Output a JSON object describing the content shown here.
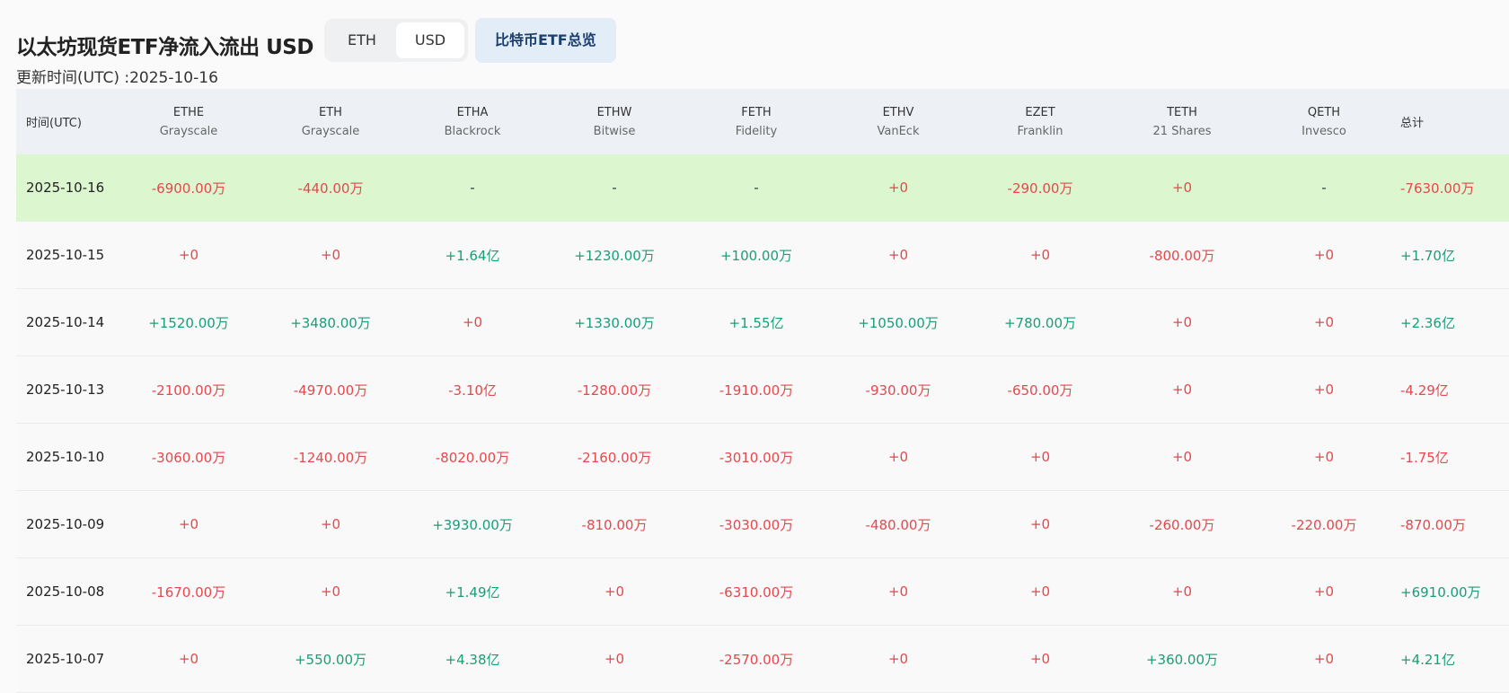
{
  "header": {
    "title": "以太坊现货ETF净流入流出 USD",
    "toggle": [
      "ETH",
      "USD"
    ],
    "toggle_selected": "USD",
    "btc_button": "比特币ETF总览",
    "updated": "更新时间(UTC) :2025-10-16"
  },
  "colors": {
    "negative": "#e5484d",
    "positive": "#1a9e76",
    "highlight_row": "#dcf7d0"
  },
  "table": {
    "date_header": "时间(UTC)",
    "total_header": "总计",
    "columns": [
      {
        "ticker": "ETHE",
        "issuer": "Grayscale"
      },
      {
        "ticker": "ETH",
        "issuer": "Grayscale"
      },
      {
        "ticker": "ETHA",
        "issuer": "Blackrock"
      },
      {
        "ticker": "ETHW",
        "issuer": "Bitwise"
      },
      {
        "ticker": "FETH",
        "issuer": "Fidelity"
      },
      {
        "ticker": "ETHV",
        "issuer": "VanEck"
      },
      {
        "ticker": "EZET",
        "issuer": "Franklin"
      },
      {
        "ticker": "TETH",
        "issuer": "21 Shares"
      },
      {
        "ticker": "QETH",
        "issuer": "Invesco"
      }
    ],
    "rows": [
      {
        "date": "2025-10-16",
        "values": [
          "-6900.00万",
          "-440.00万",
          "-",
          "-",
          "-",
          "+0",
          "-290.00万",
          "+0",
          "-"
        ],
        "total": "-7630.00万"
      },
      {
        "date": "2025-10-15",
        "values": [
          "+0",
          "+0",
          "+1.64亿",
          "+1230.00万",
          "+100.00万",
          "+0",
          "+0",
          "-800.00万",
          "+0"
        ],
        "total": "+1.70亿"
      },
      {
        "date": "2025-10-14",
        "values": [
          "+1520.00万",
          "+3480.00万",
          "+0",
          "+1330.00万",
          "+1.55亿",
          "+1050.00万",
          "+780.00万",
          "+0",
          "+0"
        ],
        "total": "+2.36亿"
      },
      {
        "date": "2025-10-13",
        "values": [
          "-2100.00万",
          "-4970.00万",
          "-3.10亿",
          "-1280.00万",
          "-1910.00万",
          "-930.00万",
          "-650.00万",
          "+0",
          "+0"
        ],
        "total": "-4.29亿"
      },
      {
        "date": "2025-10-10",
        "values": [
          "-3060.00万",
          "-1240.00万",
          "-8020.00万",
          "-2160.00万",
          "-3010.00万",
          "+0",
          "+0",
          "+0",
          "+0"
        ],
        "total": "-1.75亿"
      },
      {
        "date": "2025-10-09",
        "values": [
          "+0",
          "+0",
          "+3930.00万",
          "-810.00万",
          "-3030.00万",
          "-480.00万",
          "+0",
          "-260.00万",
          "-220.00万"
        ],
        "total": "-870.00万"
      },
      {
        "date": "2025-10-08",
        "values": [
          "-1670.00万",
          "+0",
          "+1.49亿",
          "+0",
          "-6310.00万",
          "+0",
          "+0",
          "+0",
          "+0"
        ],
        "total": "+6910.00万"
      },
      {
        "date": "2025-10-07",
        "values": [
          "+0",
          "+550.00万",
          "+4.38亿",
          "+0",
          "-2570.00万",
          "+0",
          "+0",
          "+360.00万",
          "+0"
        ],
        "total": "+4.21亿"
      }
    ]
  }
}
